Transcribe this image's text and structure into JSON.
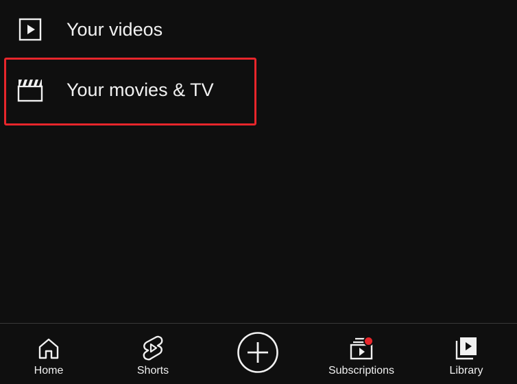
{
  "menu": {
    "items": [
      {
        "label": "Your videos",
        "icon": "play-square-icon"
      },
      {
        "label": "Your movies & TV",
        "icon": "clapperboard-icon",
        "highlighted": true
      }
    ]
  },
  "bottom_nav": {
    "items": [
      {
        "label": "Home",
        "icon": "home-icon"
      },
      {
        "label": "Shorts",
        "icon": "shorts-icon"
      },
      {
        "label": "",
        "icon": "create-plus-icon"
      },
      {
        "label": "Subscriptions",
        "icon": "subscriptions-icon",
        "has_notification": true
      },
      {
        "label": "Library",
        "icon": "library-icon"
      }
    ]
  },
  "colors": {
    "background": "#0f0f0f",
    "text": "#f1f1f1",
    "highlight_border": "#e8262b",
    "notification_dot": "#e8262b",
    "divider": "#3a3a3a"
  }
}
